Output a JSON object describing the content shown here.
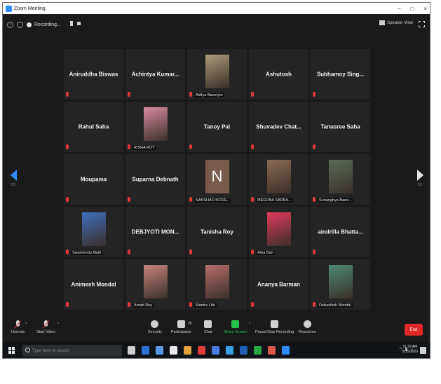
{
  "window": {
    "title": "Zoom Meeting",
    "controls": {
      "minimize": "–",
      "maximize": "□",
      "close": "×"
    }
  },
  "topbar": {
    "recording_label": "Recording...",
    "speaker_view_label": "Speaker View"
  },
  "pager": {
    "prev_label": "2/2",
    "next_label": "2/2"
  },
  "participants": [
    {
      "name": "Aniruddha Biswas",
      "style": "text"
    },
    {
      "name": "Achintya Kumar...",
      "style": "text"
    },
    {
      "name": "Aditya Banerjee",
      "style": "photo",
      "photo_color": "#a99a78"
    },
    {
      "name": "Ashutosh",
      "style": "text"
    },
    {
      "name": "Subhamoy Sing...",
      "style": "text"
    },
    {
      "name": "Rahul Saha",
      "style": "text"
    },
    {
      "name": "RISHA ROY",
      "style": "photo",
      "photo_color": "#d98aa0"
    },
    {
      "name": "Tanoy Pal",
      "style": "text"
    },
    {
      "name": "Shuvadev Chat...",
      "style": "text"
    },
    {
      "name": "Tanusree Saha",
      "style": "text"
    },
    {
      "name": "Moupama",
      "style": "text"
    },
    {
      "name": "Suparna Debnath",
      "style": "text"
    },
    {
      "name": "NAKSHAO KCSS...",
      "style": "avatar",
      "initial": "N",
      "avatar_color": "#7b5a4e"
    },
    {
      "name": "MEGHNA SARKA...",
      "style": "photo",
      "photo_color": "#8a6a52"
    },
    {
      "name": "Sunanghya Bane...",
      "style": "photo",
      "photo_color": "#5a6c58"
    },
    {
      "name": "Swarnendu Maiti",
      "style": "photo",
      "photo_color": "#3f6fbf"
    },
    {
      "name": "DEBJYOTI MON...",
      "style": "text"
    },
    {
      "name": "Tanisha Roy",
      "style": "text"
    },
    {
      "name": "Arka Ban",
      "style": "photo",
      "photo_color": "#e23a5c"
    },
    {
      "name": "aindrilla Bhatta...",
      "style": "text"
    },
    {
      "name": "Animesh Mondal",
      "style": "text"
    },
    {
      "name": "Arnab Roy",
      "style": "photo",
      "photo_color": "#c7857c"
    },
    {
      "name": "Mantra Life",
      "style": "photo",
      "photo_color": "#b86f6a"
    },
    {
      "name": "Ananya Barman",
      "style": "text"
    },
    {
      "name": "Debashish Mondal",
      "style": "photo",
      "photo_color": "#4d8a74"
    }
  ],
  "toolbar": {
    "unmute_label": "Unmute",
    "start_video_label": "Start Video",
    "security_label": "Security",
    "participants_label": "Participants",
    "participants_count": "26",
    "chat_label": "Chat",
    "share_screen_label": "Share Screen",
    "recording_label": "Pause/Stop Recording",
    "reactions_label": "Reactions",
    "end_label": "End",
    "accent_green": "#24c04b",
    "end_color": "#e02828"
  },
  "taskbar": {
    "search_placeholder": "Type here to search",
    "time": "11:29 AM",
    "date": "5/15/2020",
    "app_colors": [
      "#cfcfcf",
      "#2f6fd6",
      "#5a9be6",
      "#e8e8e8",
      "#e2a13a",
      "#e23a3a",
      "#4b7be0",
      "#3aa0e6",
      "#1f5fb8",
      "#28a845",
      "#d9574a",
      "#2d8cff"
    ]
  }
}
